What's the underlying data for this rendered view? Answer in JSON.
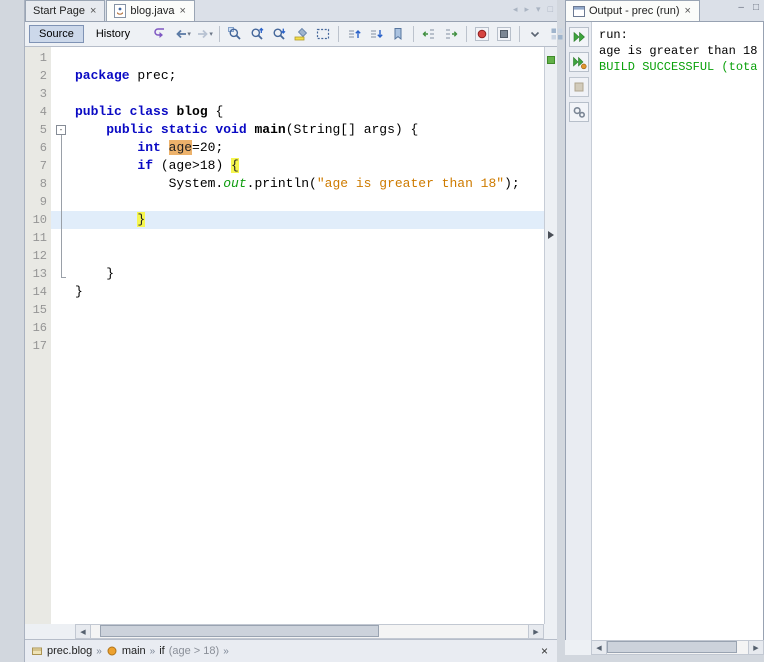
{
  "tabs": {
    "items": [
      {
        "name": "start-page",
        "label": "Start Page",
        "close_glyph": "×",
        "active": false
      },
      {
        "name": "blog-java",
        "label": "blog.java",
        "close_glyph": "×",
        "active": true,
        "icon": "java-file"
      }
    ],
    "controls": [
      {
        "name": "scroll-tabs-left",
        "glyph": "◂"
      },
      {
        "name": "scroll-tabs-right",
        "glyph": "▸"
      },
      {
        "name": "opened-documents-list",
        "glyph": "▾"
      },
      {
        "name": "maximize-window",
        "glyph": "□"
      }
    ]
  },
  "window_controls": [
    {
      "name": "minimize-window",
      "glyph": "–"
    },
    {
      "name": "restore-window",
      "glyph": "□"
    }
  ],
  "toolbar": {
    "source_label": "Source",
    "history_label": "History",
    "dropdown_glyph": "▾",
    "groups": [
      [
        "last-edit",
        "back",
        "forward"
      ],
      [
        "find-selection",
        "find-previous",
        "find-next",
        "toggle-highlight",
        "rectangular-selection"
      ],
      [
        "previous-bookmark",
        "next-bookmark",
        "toggle-bookmark"
      ],
      [
        "shift-line-left",
        "shift-line-right"
      ],
      [
        "start-macro-recording",
        "stop-macro-recording"
      ],
      [
        "collapse-toolbar",
        "insert-palette"
      ]
    ]
  },
  "editor": {
    "fold_glyph": "-",
    "lines": [
      {
        "n": "1",
        "fold": "",
        "caret": false,
        "tokens": []
      },
      {
        "n": "2",
        "fold": "",
        "caret": false,
        "tokens": [
          {
            "t": "package",
            "c": "kw"
          },
          {
            "t": " prec;",
            "c": "pl"
          }
        ]
      },
      {
        "n": "3",
        "fold": "",
        "caret": false,
        "tokens": []
      },
      {
        "n": "4",
        "fold": "",
        "caret": false,
        "tokens": [
          {
            "t": "public class",
            "c": "kw"
          },
          {
            "t": " ",
            "c": "pl"
          },
          {
            "t": "blog",
            "c": "bd"
          },
          {
            "t": " {",
            "c": "pl"
          }
        ]
      },
      {
        "n": "5",
        "fold": "start",
        "caret": false,
        "tokens": [
          {
            "t": "    ",
            "c": "pl"
          },
          {
            "t": "public static void",
            "c": "kw"
          },
          {
            "t": " ",
            "c": "pl"
          },
          {
            "t": "main",
            "c": "bd"
          },
          {
            "t": "(String[] args) {",
            "c": "pl"
          }
        ]
      },
      {
        "n": "6",
        "fold": "mid",
        "caret": false,
        "tokens": [
          {
            "t": "        ",
            "c": "pl"
          },
          {
            "t": "int",
            "c": "kw"
          },
          {
            "t": " ",
            "c": "pl"
          },
          {
            "t": "age",
            "c": "occ"
          },
          {
            "t": "=20;",
            "c": "pl"
          }
        ]
      },
      {
        "n": "7",
        "fold": "mid",
        "caret": false,
        "tokens": [
          {
            "t": "        ",
            "c": "pl"
          },
          {
            "t": "if",
            "c": "kw"
          },
          {
            "t": " (age>18) ",
            "c": "pl"
          },
          {
            "t": "{",
            "c": "br"
          }
        ]
      },
      {
        "n": "8",
        "fold": "mid",
        "caret": false,
        "tokens": [
          {
            "t": "            System.",
            "c": "pl"
          },
          {
            "t": "out",
            "c": "fd"
          },
          {
            "t": ".println(",
            "c": "pl"
          },
          {
            "t": "\"age is greater than 18\"",
            "c": "st"
          },
          {
            "t": ");",
            "c": "pl"
          }
        ]
      },
      {
        "n": "9",
        "fold": "mid",
        "caret": false,
        "tokens": []
      },
      {
        "n": "10",
        "fold": "mid",
        "caret": true,
        "tokens": [
          {
            "t": "        ",
            "c": "pl"
          },
          {
            "t": "}",
            "c": "br"
          }
        ]
      },
      {
        "n": "11",
        "fold": "mid",
        "caret": false,
        "tokens": []
      },
      {
        "n": "12",
        "fold": "mid",
        "caret": false,
        "tokens": []
      },
      {
        "n": "13",
        "fold": "end",
        "caret": false,
        "tokens": [
          {
            "t": "    }",
            "c": "pl"
          }
        ]
      },
      {
        "n": "14",
        "fold": "",
        "caret": false,
        "tokens": [
          {
            "t": "}",
            "c": "pl"
          }
        ]
      },
      {
        "n": "15",
        "fold": "",
        "caret": false,
        "tokens": []
      },
      {
        "n": "16",
        "fold": "",
        "caret": false,
        "tokens": []
      },
      {
        "n": "17",
        "fold": "",
        "caret": false,
        "tokens": []
      }
    ]
  },
  "output": {
    "tab_label": "Output - prec (run)",
    "tab_close_glyph": "×",
    "toolbar": [
      {
        "name": "rerun",
        "disabled": false
      },
      {
        "name": "rerun-with-changes",
        "disabled": false
      },
      {
        "name": "stop",
        "disabled": true
      },
      {
        "name": "build-settings",
        "disabled": false
      }
    ],
    "lines": [
      {
        "text": "run:",
        "color": "#000000"
      },
      {
        "text": "age is greater than 18",
        "color": "#000000"
      },
      {
        "text": "BUILD SUCCESSFUL (tota",
        "color": "#0aa10a"
      }
    ]
  },
  "breadcrumb": {
    "separator_glyph": "»",
    "close_glyph": "×",
    "items": [
      {
        "icon": "package",
        "label": "prec.blog",
        "detail": ""
      },
      {
        "icon": "method",
        "label": "main",
        "detail": ""
      },
      {
        "icon": "",
        "label": "if",
        "detail": "(age > 18)"
      }
    ]
  },
  "scrollbars": {
    "left_glyph": "◀",
    "right_glyph": "▶"
  },
  "colors": {
    "keyword": "#0a0ac4",
    "string": "#ce7b00",
    "static_field": "#0e9c0e",
    "occurrence_highlight": "#edb26b",
    "brace_highlight": "#f6f64f",
    "caret_row": "#e1edfa",
    "build_success": "#0aa10a",
    "error_stripe_ok": "#62b148"
  }
}
